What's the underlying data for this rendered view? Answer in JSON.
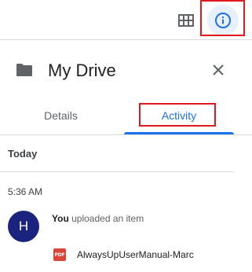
{
  "topbar": {
    "grid_icon": "grid-view-icon",
    "info_icon": "info-icon"
  },
  "panel": {
    "folder_icon": "folder-icon",
    "title": "My Drive",
    "close_icon": "close-icon"
  },
  "tabs": {
    "items": [
      {
        "label": "Details",
        "active": false
      },
      {
        "label": "Activity",
        "active": true
      }
    ]
  },
  "activity": {
    "section": "Today",
    "time": "5:36 AM",
    "avatar_letter": "H",
    "actor": "You",
    "action": " uploaded an item",
    "file": {
      "icon_label": "PDF",
      "name": "AlwaysUpUserManual-Marc"
    }
  },
  "colors": {
    "accent": "#1a73e8",
    "highlight_box": "#e0191f",
    "avatar_bg": "#1a237e",
    "pdf": "#db4437"
  }
}
